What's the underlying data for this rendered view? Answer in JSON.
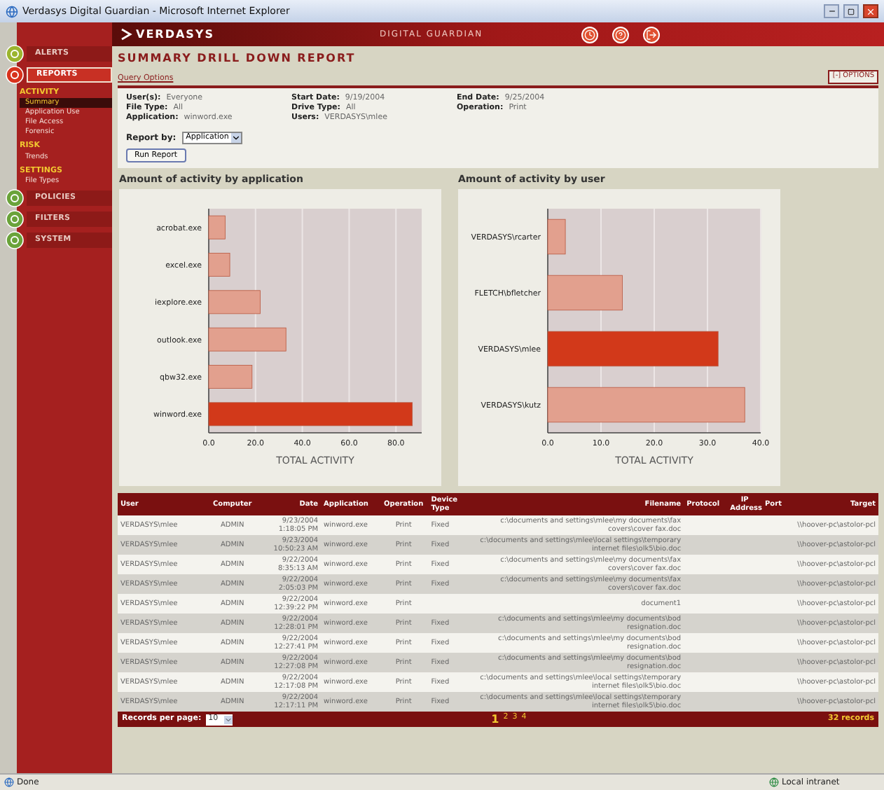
{
  "window": {
    "title": "Verdasys Digital Guardian - Microsoft Internet Explorer"
  },
  "header": {
    "logo": "VERDASYS",
    "product": "DIGITAL GUARDIAN"
  },
  "sidebar": {
    "items": [
      {
        "label": "ALERTS",
        "selected": false
      },
      {
        "label": "REPORTS",
        "selected": true,
        "sections": [
          {
            "heading": "ACTIVITY",
            "items": [
              {
                "label": "Summary",
                "selected": true
              },
              {
                "label": "Application Use",
                "selected": false
              },
              {
                "label": "File Access",
                "selected": false
              },
              {
                "label": "Forensic",
                "selected": false
              }
            ]
          },
          {
            "heading": "RISK",
            "items": [
              {
                "label": "Trends",
                "selected": false
              }
            ]
          },
          {
            "heading": "SETTINGS",
            "items": [
              {
                "label": "File Types",
                "selected": false
              }
            ]
          }
        ]
      },
      {
        "label": "POLICIES",
        "selected": false
      },
      {
        "label": "FILTERS",
        "selected": false
      },
      {
        "label": "SYSTEM",
        "selected": false
      }
    ]
  },
  "page": {
    "title": "SUMMARY DRILL DOWN REPORT",
    "options_link": "Query Options",
    "options_toggle": "[-] OPTIONS"
  },
  "query": {
    "fields": [
      {
        "label": "User(s):",
        "value": "Everyone"
      },
      {
        "label": "Start Date:",
        "value": "9/19/2004"
      },
      {
        "label": "End Date:",
        "value": "9/25/2004"
      },
      {
        "label": "File Type:",
        "value": "All"
      },
      {
        "label": "Drive Type:",
        "value": "All"
      },
      {
        "label": "Operation:",
        "value": "Print"
      },
      {
        "label": "Application:",
        "value": "winword.exe"
      },
      {
        "label": "Users:",
        "value": "VERDASYS\\mlee"
      }
    ],
    "report_by": {
      "label": "Report by:",
      "value": "Application"
    },
    "run_button": "Run Report"
  },
  "charts": [
    {
      "title": "Amount of activity by application",
      "chart_data": {
        "type": "bar",
        "orientation": "horizontal",
        "grid": true,
        "xlabel": "TOTAL ACTIVITY",
        "categories": [
          "acrobat.exe",
          "excel.exe",
          "iexplore.exe",
          "outlook.exe",
          "qbw32.exe",
          "winword.exe"
        ],
        "series": [
          {
            "color": "#e2a08e",
            "values": [
              7,
              9,
              22,
              33,
              18.5,
              null
            ]
          },
          {
            "color": "#d2391a",
            "values": [
              null,
              null,
              null,
              null,
              null,
              87
            ]
          }
        ],
        "xlim": [
          0,
          91
        ],
        "xticks": [
          {
            "value": 0,
            "label": "0.0"
          },
          {
            "value": 20,
            "label": "20.0"
          },
          {
            "value": 40,
            "label": "40.0"
          },
          {
            "value": 60,
            "label": "60.0"
          },
          {
            "value": 80,
            "label": "80.0"
          }
        ]
      }
    },
    {
      "title": "Amount of activity by user",
      "chart_data": {
        "type": "bar",
        "orientation": "horizontal",
        "grid": true,
        "xlabel": "TOTAL ACTIVITY",
        "categories": [
          "VERDASYS\\rcarter",
          "FLETCH\\bfletcher",
          "VERDASYS\\mlee",
          "VERDASYS\\kutz"
        ],
        "series": [
          {
            "color": "#e2a08e",
            "values": [
              3.3,
              14,
              null,
              37
            ]
          },
          {
            "color": "#d2391a",
            "values": [
              null,
              null,
              32,
              null
            ]
          }
        ],
        "xlim": [
          0,
          40
        ],
        "xticks": [
          {
            "value": 0,
            "label": "0.0"
          },
          {
            "value": 10,
            "label": "10.0"
          },
          {
            "value": 20,
            "label": "20.0"
          },
          {
            "value": 30,
            "label": "30.0"
          },
          {
            "value": 40,
            "label": "40.0"
          }
        ]
      }
    }
  ],
  "table": {
    "columns": [
      "User",
      "Computer",
      "Date",
      "Application",
      "Operation",
      "Device Type",
      "Filename",
      "Protocol",
      "IP Address",
      "Port",
      "Target"
    ],
    "rows": [
      {
        "user": "VERDASYS\\mlee",
        "computer": "ADMIN",
        "date": "9/23/2004 1:18:05 PM",
        "application": "winword.exe",
        "operation": "Print",
        "device_type": "Fixed",
        "filename": "c:\\documents and settings\\mlee\\my documents\\fax covers\\cover fax.doc",
        "target": "\\\\hoover-pc\\astolor-pcl"
      },
      {
        "user": "VERDASYS\\mlee",
        "computer": "ADMIN",
        "date": "9/23/2004 10:50:23 AM",
        "application": "winword.exe",
        "operation": "Print",
        "device_type": "Fixed",
        "filename": "c:\\documents and settings\\mlee\\local settings\\temporary internet files\\olk5\\bio.doc",
        "target": "\\\\hoover-pc\\astolor-pcl"
      },
      {
        "user": "VERDASYS\\mlee",
        "computer": "ADMIN",
        "date": "9/22/2004 8:35:13 AM",
        "application": "winword.exe",
        "operation": "Print",
        "device_type": "Fixed",
        "filename": "c:\\documents and settings\\mlee\\my documents\\fax covers\\cover fax.doc",
        "target": "\\\\hoover-pc\\astolor-pcl"
      },
      {
        "user": "VERDASYS\\mlee",
        "computer": "ADMIN",
        "date": "9/22/2004 2:05:03 PM",
        "application": "winword.exe",
        "operation": "Print",
        "device_type": "Fixed",
        "filename": "c:\\documents and settings\\mlee\\my documents\\fax covers\\cover fax.doc",
        "target": "\\\\hoover-pc\\astolor-pcl"
      },
      {
        "user": "VERDASYS\\mlee",
        "computer": "ADMIN",
        "date": "9/22/2004 12:39:22 PM",
        "application": "winword.exe",
        "operation": "Print",
        "filename": "document1",
        "target": "\\\\hoover-pc\\astolor-pcl"
      },
      {
        "user": "VERDASYS\\mlee",
        "computer": "ADMIN",
        "date": "9/22/2004 12:28:01 PM",
        "application": "winword.exe",
        "operation": "Print",
        "device_type": "Fixed",
        "filename": "c:\\documents and settings\\mlee\\my documents\\bod resignation.doc",
        "target": "\\\\hoover-pc\\astolor-pcl"
      },
      {
        "user": "VERDASYS\\mlee",
        "computer": "ADMIN",
        "date": "9/22/2004 12:27:41 PM",
        "application": "winword.exe",
        "operation": "Print",
        "device_type": "Fixed",
        "filename": "c:\\documents and settings\\mlee\\my documents\\bod resignation.doc",
        "target": "\\\\hoover-pc\\astolor-pcl"
      },
      {
        "user": "VERDASYS\\mlee",
        "computer": "ADMIN",
        "date": "9/22/2004 12:27:08 PM",
        "application": "winword.exe",
        "operation": "Print",
        "device_type": "Fixed",
        "filename": "c:\\documents and settings\\mlee\\my documents\\bod resignation.doc",
        "target": "\\\\hoover-pc\\astolor-pcl"
      },
      {
        "user": "VERDASYS\\mlee",
        "computer": "ADMIN",
        "date": "9/22/2004 12:17:08 PM",
        "application": "winword.exe",
        "operation": "Print",
        "device_type": "Fixed",
        "filename": "c:\\documents and settings\\mlee\\local settings\\temporary internet files\\olk5\\bio.doc",
        "target": "\\\\hoover-pc\\astolor-pcl"
      },
      {
        "user": "VERDASYS\\mlee",
        "computer": "ADMIN",
        "date": "9/22/2004 12:17:11 PM",
        "application": "winword.exe",
        "operation": "Print",
        "device_type": "Fixed",
        "filename": "c:\\documents and settings\\mlee\\local settings\\temporary internet files\\olk5\\bio.doc",
        "target": "\\\\hoover-pc\\astolor-pcl"
      }
    ],
    "footer": {
      "records_label": "Records per page:",
      "per_page": "10",
      "pages": [
        {
          "label": "1",
          "selected": true
        },
        {
          "label": "2",
          "selected": false
        },
        {
          "label": "3",
          "selected": false
        },
        {
          "label": "4",
          "selected": false
        }
      ],
      "count": "32 records"
    }
  },
  "status_bar": {
    "text": "Done",
    "zone": "Local intranet"
  }
}
